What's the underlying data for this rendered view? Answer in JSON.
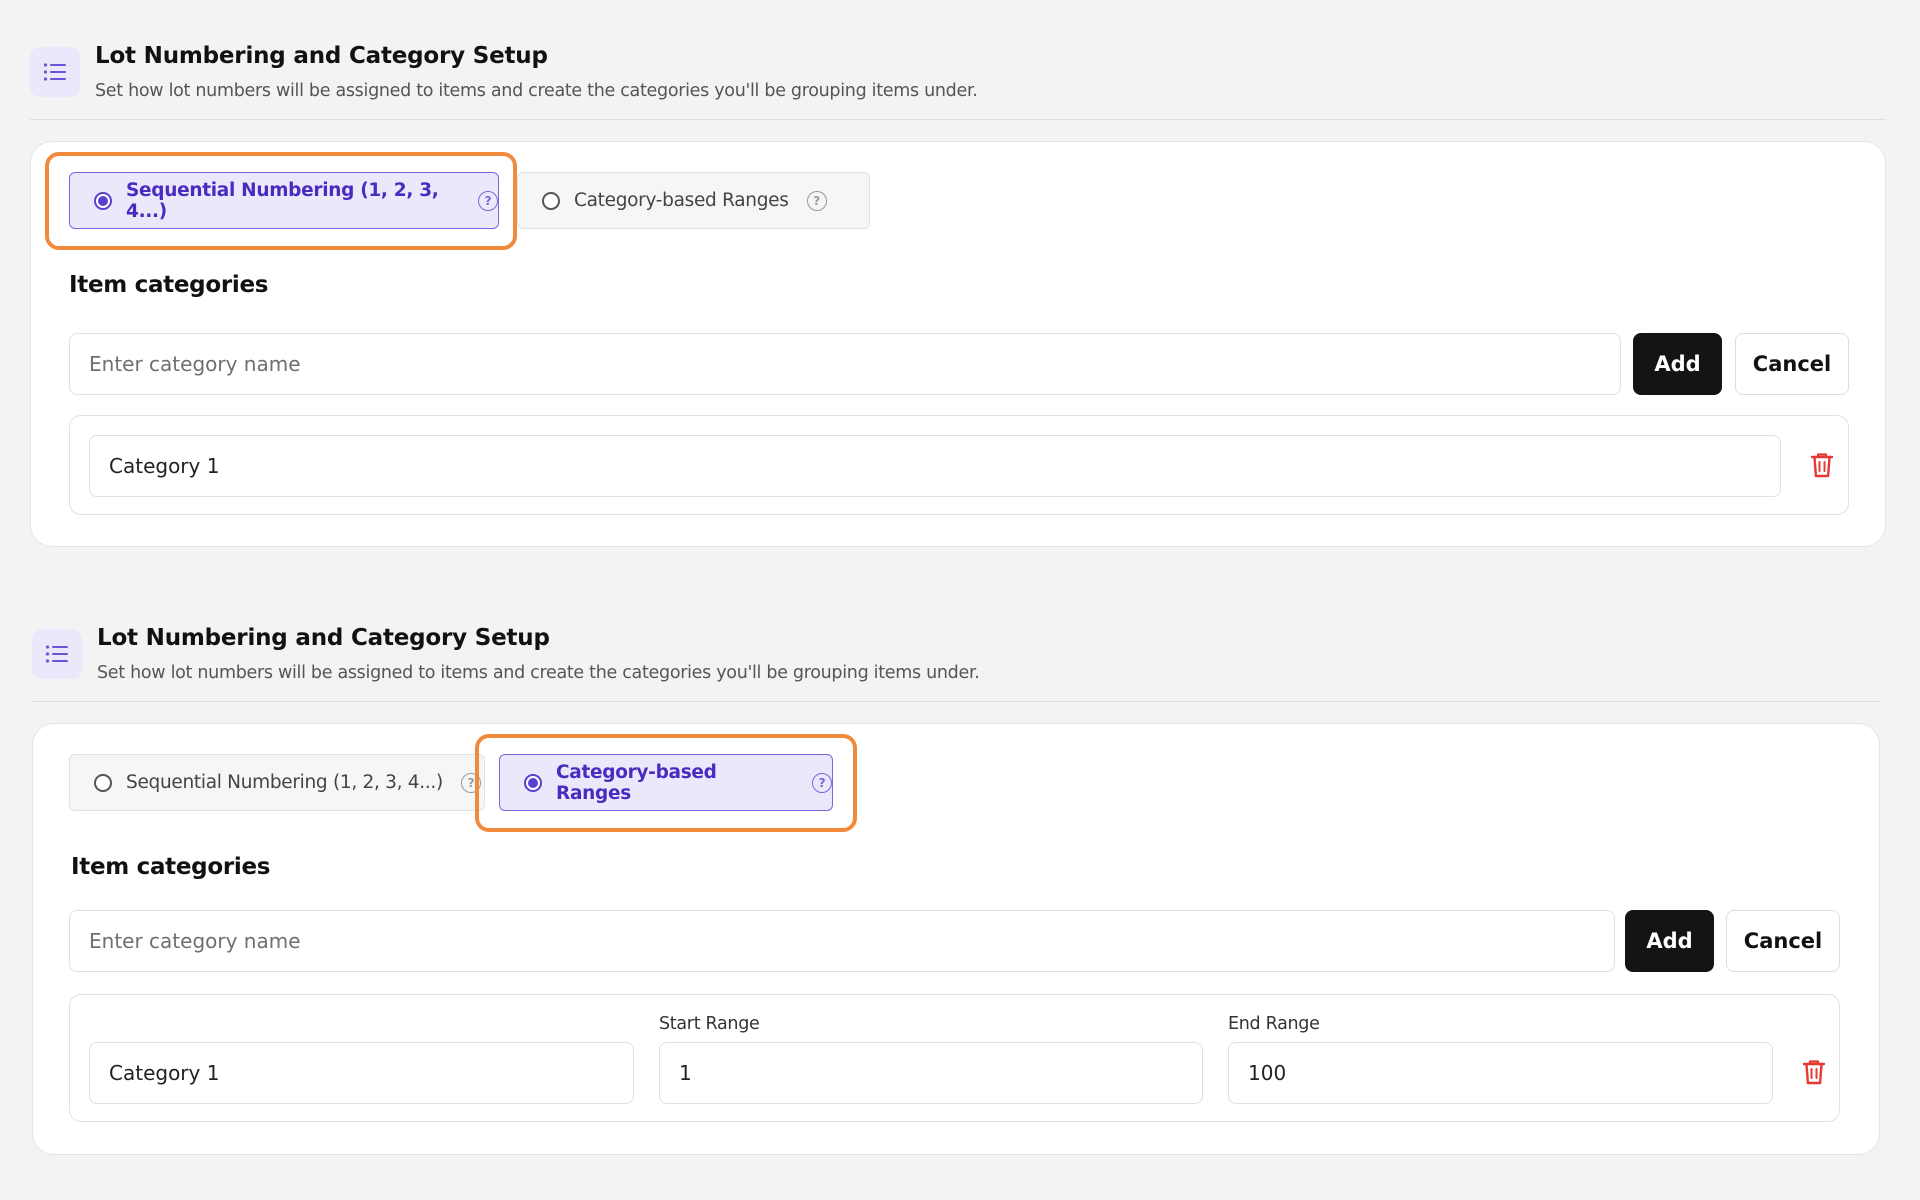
{
  "sections": [
    {
      "title": "Lot Numbering and Category Setup",
      "subtitle": "Set how lot numbers will be assigned to items and create the categories you'll be grouping items under.",
      "options": [
        {
          "label": "Sequential Numbering (1, 2, 3, 4...)",
          "selected": true
        },
        {
          "label": "Category-based Ranges",
          "selected": false
        }
      ],
      "items_title": "Item categories",
      "new_category_placeholder": "Enter category name",
      "add_label": "Add",
      "cancel_label": "Cancel",
      "categories": [
        {
          "name": "Category 1"
        }
      ]
    },
    {
      "title": "Lot Numbering and Category Setup",
      "subtitle": "Set how lot numbers will be assigned to items and create the categories you'll be grouping items under.",
      "options": [
        {
          "label": "Sequential Numbering (1, 2, 3, 4...)",
          "selected": false
        },
        {
          "label": "Category-based Ranges",
          "selected": true
        }
      ],
      "items_title": "Item categories",
      "new_category_placeholder": "Enter category name",
      "add_label": "Add",
      "cancel_label": "Cancel",
      "start_range_label": "Start Range",
      "end_range_label": "End Range",
      "categories": [
        {
          "name": "Category 1",
          "start": "1",
          "end": "100"
        }
      ]
    }
  ],
  "colors": {
    "accent": "#5a3fd0",
    "accent_bg": "#ece8fc",
    "highlight": "#f28a3c",
    "danger": "#e53935"
  },
  "icons": {
    "header": "list-icon",
    "help": "help-circle-icon",
    "delete": "trash-icon"
  }
}
